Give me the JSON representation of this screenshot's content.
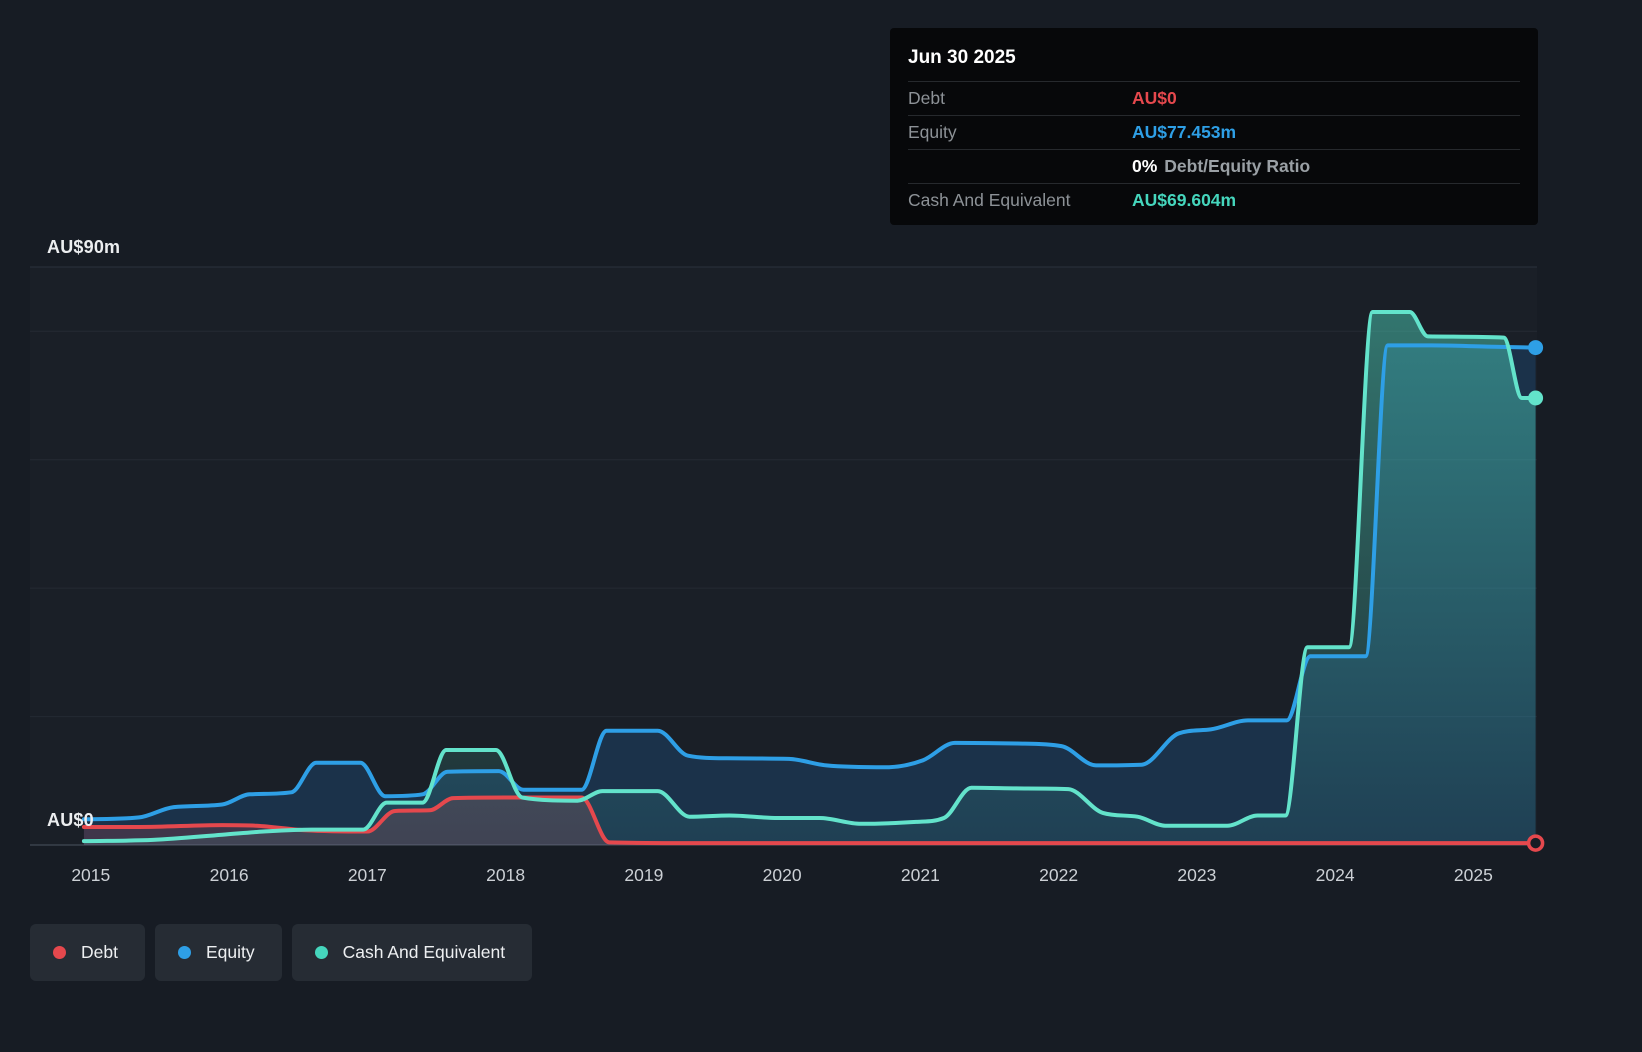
{
  "tooltip": {
    "date": "Jun 30 2025",
    "debt_label": "Debt",
    "debt_value": "AU$0",
    "equity_label": "Equity",
    "equity_value": "AU$77.453m",
    "ratio_value": "0%",
    "ratio_label": "Debt/Equity Ratio",
    "cash_label": "Cash And Equivalent",
    "cash_value": "AU$69.604m"
  },
  "colors": {
    "background": "#171c24",
    "tooltip_background": "#07080a",
    "gridline": "#242a33",
    "legend_pill_background": "#262c34"
  },
  "chart_data": {
    "type": "area",
    "unit": "AU$m",
    "x_range": [
      2014.56,
      2025.46
    ],
    "x_ticks": [
      "2015",
      "2016",
      "2017",
      "2018",
      "2019",
      "2020",
      "2021",
      "2022",
      "2023",
      "2024",
      "2025"
    ],
    "ylim": [
      0,
      90
    ],
    "gridlines": [
      20,
      40,
      60,
      80
    ],
    "grid": "horizontal",
    "legend_position": "bottom-left",
    "y_axis_labels": {
      "top": "AU$90m",
      "zero": "AU$0"
    },
    "series": [
      {
        "name": "Debt",
        "color": "#e5484d",
        "line_color": "#e5484d",
        "fill": "rgba(229,72,77,0.18)",
        "end_marker": "ring",
        "points": [
          [
            2014.95,
            2.8
          ],
          [
            2015.35,
            2.8
          ],
          [
            2015.95,
            3.1
          ],
          [
            2016.2,
            3.0
          ],
          [
            2016.55,
            2.3
          ],
          [
            2017.0,
            2.1
          ],
          [
            2017.2,
            5.3
          ],
          [
            2017.45,
            5.4
          ],
          [
            2017.62,
            7.3
          ],
          [
            2018.0,
            7.4
          ],
          [
            2018.55,
            7.4
          ],
          [
            2018.75,
            0.4
          ],
          [
            2019.3,
            0.3
          ],
          [
            2020.5,
            0.3
          ],
          [
            2022.0,
            0.3
          ],
          [
            2024.0,
            0.3
          ],
          [
            2025.45,
            0.3
          ]
        ]
      },
      {
        "name": "Equity",
        "color": "#2e9fe6",
        "line_color": "#2e9fe6",
        "fill": "rgba(30,120,200,0.22)",
        "end_marker": "solid",
        "points": [
          [
            2014.95,
            4.0
          ],
          [
            2015.35,
            4.3
          ],
          [
            2015.6,
            5.9
          ],
          [
            2015.95,
            6.3
          ],
          [
            2016.15,
            7.9
          ],
          [
            2016.45,
            8.2
          ],
          [
            2016.63,
            12.8
          ],
          [
            2016.95,
            12.8
          ],
          [
            2017.13,
            7.6
          ],
          [
            2017.4,
            7.9
          ],
          [
            2017.58,
            11.4
          ],
          [
            2017.95,
            11.5
          ],
          [
            2018.13,
            8.6
          ],
          [
            2018.55,
            8.6
          ],
          [
            2018.73,
            17.8
          ],
          [
            2019.1,
            17.8
          ],
          [
            2019.32,
            13.9
          ],
          [
            2019.6,
            13.5
          ],
          [
            2020.05,
            13.4
          ],
          [
            2020.32,
            12.4
          ],
          [
            2020.75,
            12.1
          ],
          [
            2021.02,
            13.2
          ],
          [
            2021.25,
            15.9
          ],
          [
            2021.7,
            15.8
          ],
          [
            2022.02,
            15.4
          ],
          [
            2022.27,
            12.4
          ],
          [
            2022.6,
            12.5
          ],
          [
            2022.87,
            17.4
          ],
          [
            2023.1,
            18.0
          ],
          [
            2023.37,
            19.4
          ],
          [
            2023.65,
            19.4
          ],
          [
            2023.82,
            29.4
          ],
          [
            2024.22,
            29.4
          ],
          [
            2024.38,
            77.8
          ],
          [
            2024.7,
            77.8
          ],
          [
            2025.1,
            77.6
          ],
          [
            2025.45,
            77.453
          ]
        ]
      },
      {
        "name": "Cash And Equivalent",
        "color": "#45d6bd",
        "line_color": "#63e3cb",
        "fill": "teal-gradient",
        "end_marker": "solid",
        "points": [
          [
            2014.95,
            0.6
          ],
          [
            2015.45,
            0.8
          ],
          [
            2015.95,
            1.6
          ],
          [
            2016.25,
            2.1
          ],
          [
            2016.6,
            2.4
          ],
          [
            2016.97,
            2.4
          ],
          [
            2017.14,
            6.6
          ],
          [
            2017.4,
            6.6
          ],
          [
            2017.57,
            14.8
          ],
          [
            2017.93,
            14.8
          ],
          [
            2018.12,
            7.4
          ],
          [
            2018.52,
            6.9
          ],
          [
            2018.7,
            8.4
          ],
          [
            2019.1,
            8.4
          ],
          [
            2019.33,
            4.4
          ],
          [
            2019.62,
            4.6
          ],
          [
            2019.97,
            4.2
          ],
          [
            2020.27,
            4.2
          ],
          [
            2020.57,
            3.3
          ],
          [
            2020.97,
            3.6
          ],
          [
            2021.17,
            4.2
          ],
          [
            2021.37,
            8.9
          ],
          [
            2021.77,
            8.8
          ],
          [
            2022.07,
            8.7
          ],
          [
            2022.32,
            5.0
          ],
          [
            2022.57,
            4.4
          ],
          [
            2022.77,
            3.0
          ],
          [
            2023.22,
            3.0
          ],
          [
            2023.44,
            4.6
          ],
          [
            2023.64,
            4.6
          ],
          [
            2023.8,
            30.8
          ],
          [
            2024.1,
            30.8
          ],
          [
            2024.27,
            83.0
          ],
          [
            2024.54,
            83.0
          ],
          [
            2024.67,
            79.2
          ],
          [
            2025.22,
            79.0
          ],
          [
            2025.35,
            69.604
          ],
          [
            2025.45,
            69.604
          ]
        ]
      }
    ]
  }
}
